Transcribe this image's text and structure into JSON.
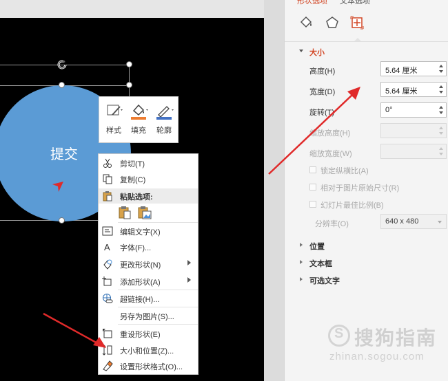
{
  "pane": {
    "tabs": [
      "形状选项",
      "文本选项"
    ],
    "accent_color": "#d24726",
    "size_section": {
      "title": "大小",
      "height": {
        "label": "高度(H)",
        "value": "5.64 厘米"
      },
      "width": {
        "label": "宽度(D)",
        "value": "5.64 厘米"
      },
      "rotation": {
        "label": "旋转(T)",
        "value": "0°"
      },
      "scale_height": {
        "label": "缩放高度(H)",
        "value": ""
      },
      "scale_width": {
        "label": "缩放宽度(W)",
        "value": ""
      },
      "lock_aspect": "锁定纵横比(A)",
      "relative_original": "相对于图片原始尺寸(R)",
      "best_scale": "幻灯片最佳比例(B)",
      "resolution_label": "分辨率(O)",
      "resolution_value": "640 x 480"
    },
    "sections": [
      "位置",
      "文本框",
      "可选文字"
    ]
  },
  "shape": {
    "text": "提交",
    "fill_color": "#5b9bd5"
  },
  "mini_toolbar": {
    "style_label": "样式",
    "fill_label": "填充",
    "outline_label": "轮廓"
  },
  "context_menu": {
    "cut": "剪切(T)",
    "copy": "复制(C)",
    "paste_header": "粘贴选项:",
    "edit_text": "编辑文字(X)",
    "font": "字体(F)...",
    "change_shape": "更改形状(N)",
    "add_shape": "添加形状(A)",
    "hyperlink": "超链接(H)...",
    "save_as_picture": "另存为图片(S)...",
    "reset_shape": "重设形状(E)",
    "size_position": "大小和位置(Z)...",
    "format_shape": "设置形状格式(O)..."
  },
  "watermark": {
    "text": "搜狗指南",
    "url": "zhinan.sogou.com"
  }
}
